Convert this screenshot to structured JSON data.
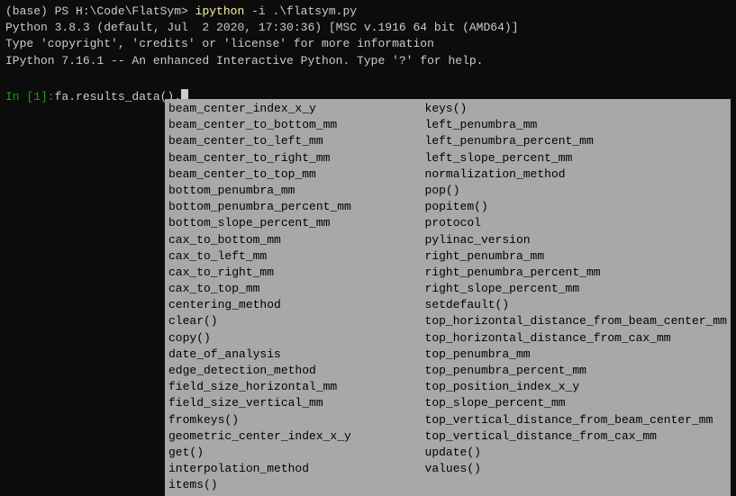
{
  "header": {
    "line1_prefix": "(base) PS H:\\Code\\FlatSym> ",
    "line1_command": "ipython",
    "line1_args": " -i .\\flatsym.py",
    "line2": "Python 3.8.3 (default, Jul  2 2020, 17:30:36) [MSC v.1916 64 bit (AMD64)]",
    "line3": "Type 'copyright', 'credits' or 'license' for more information",
    "line4": "IPython 7.16.1 -- An enhanced Interactive Python. Type '?' for help."
  },
  "input": {
    "prompt": "In [1]: ",
    "text": "fa.results_data()."
  },
  "completions": {
    "col1": [
      "beam_center_index_x_y",
      "beam_center_to_bottom_mm",
      "beam_center_to_left_mm",
      "beam_center_to_right_mm",
      "beam_center_to_top_mm",
      "bottom_penumbra_mm",
      "bottom_penumbra_percent_mm",
      "bottom_slope_percent_mm",
      "cax_to_bottom_mm",
      "cax_to_left_mm",
      "cax_to_right_mm",
      "cax_to_top_mm",
      "centering_method",
      "clear()",
      "copy()",
      "date_of_analysis",
      "edge_detection_method",
      "field_size_horizontal_mm",
      "field_size_vertical_mm",
      "fromkeys()",
      "geometric_center_index_x_y",
      "get()",
      "interpolation_method",
      "items()"
    ],
    "col2": [
      "keys()",
      "left_penumbra_mm",
      "left_penumbra_percent_mm",
      "left_slope_percent_mm",
      "normalization_method",
      "pop()",
      "popitem()",
      "protocol",
      "pylinac_version",
      "right_penumbra_mm",
      "right_penumbra_percent_mm",
      "right_slope_percent_mm",
      "setdefault()",
      "top_horizontal_distance_from_beam_center_mm",
      "top_horizontal_distance_from_cax_mm",
      "top_penumbra_mm",
      "top_penumbra_percent_mm",
      "top_position_index_x_y",
      "top_slope_percent_mm",
      "top_vertical_distance_from_beam_center_mm",
      "top_vertical_distance_from_cax_mm",
      "update()",
      "values()"
    ]
  }
}
